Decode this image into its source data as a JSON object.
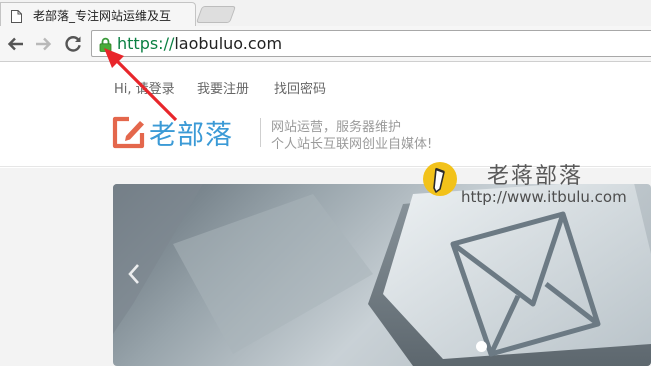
{
  "browser": {
    "tab": {
      "title": "老部落_专注网站运维及互"
    },
    "address_bar": {
      "scheme": "https://",
      "host": "laobuluo.com"
    },
    "icons": [
      "page-icon",
      "back-arrow-icon",
      "forward-arrow-icon",
      "reload-icon",
      "lock-icon"
    ]
  },
  "site": {
    "top_links": [
      "Hi, 请登录",
      "我要注册",
      "找回密码"
    ],
    "logo": {
      "name": "老部落",
      "tagline_1": "网站运营，服务器维护",
      "tagline_2": "个人站长互联网创业自媒体!"
    },
    "slider": {
      "slides_indicator_active": 1
    }
  },
  "watermark": {
    "title": "老蒋部落",
    "url": "http://www.itbulu.com"
  },
  "colors": {
    "secure_green": "#0b8043",
    "logo_blue": "#3b9ad6",
    "logo_orange": "#e4674c",
    "annotation_red": "#e8262b",
    "watermark_yellow": "#f2c21a"
  }
}
